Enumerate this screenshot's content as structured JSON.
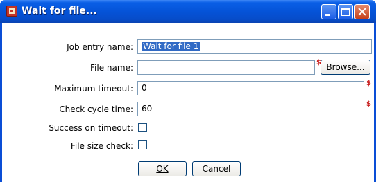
{
  "window": {
    "title": "Wait for file..."
  },
  "fields": {
    "job_entry_name": {
      "label": "Job entry name:",
      "value": "Wait for file 1"
    },
    "file_name": {
      "label": "File name:",
      "value": "",
      "browse_label": "Browse..."
    },
    "maximum_timeout": {
      "label": "Maximum timeout:",
      "value": "0"
    },
    "check_cycle_time": {
      "label": "Check cycle time:",
      "value": "60"
    },
    "success_on_timeout": {
      "label": "Success on timeout:",
      "checked": false
    },
    "file_size_check": {
      "label": "File size check:",
      "checked": false
    }
  },
  "buttons": {
    "ok": "OK",
    "cancel": "Cancel"
  },
  "variable_indicator": "$",
  "colors": {
    "titlebar": "#0553d8",
    "selection": "#316ac5",
    "variable_icon": "#c81e1e"
  }
}
